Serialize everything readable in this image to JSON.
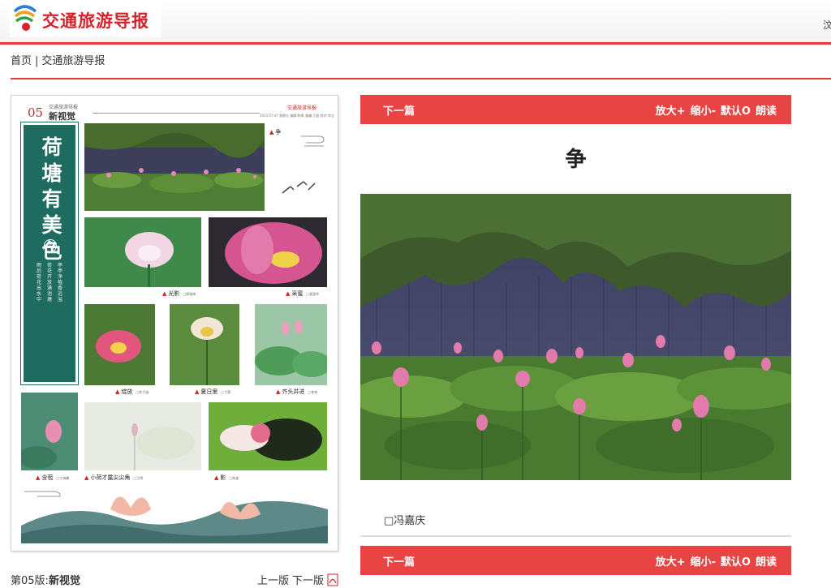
{
  "header": {
    "logo_text": "交通旅游导报",
    "right_text": "汶"
  },
  "breadcrumb": {
    "home": "首页",
    "separator": "|",
    "current": "交通旅游导报"
  },
  "paper": {
    "page_number": "05",
    "edition_small": "交通旅游导报",
    "edition_name": "新视觉",
    "brand": "交通旅游导报",
    "date_line": "2023.07.07 星期五 编辑:陈果 美编:王超 校对:李立",
    "feature_title": "荷塘有美色",
    "feature_number": "②",
    "side_text_1": "雨后荷花出水中",
    "side_text_2": "荷花开放满池塘",
    "side_text_3": "亭亭净植香远溢",
    "captions": [
      {
        "label": "光影",
        "author": "□周瑞琦"
      },
      {
        "label": "采蜜",
        "author": "□袁银华"
      },
      {
        "label": "绽放",
        "author": "□徐子涵"
      },
      {
        "label": "夏日里",
        "author": "□丁燕"
      },
      {
        "label": "齐头并进",
        "author": "□李林"
      },
      {
        "label": "含苞",
        "author": "□丁海峰"
      },
      {
        "label": "小荷才露尖尖角",
        "author": "□王明"
      },
      {
        "label": "影",
        "author": "□朱波"
      }
    ],
    "top_caption_side": "争"
  },
  "paper_footer": {
    "edition_label": "第05版:",
    "edition_name": "新视觉",
    "prev": "上一版",
    "next": "下一版"
  },
  "toolbar": {
    "next_article": "下一篇",
    "zoom_in": "放大+",
    "zoom_out": "缩小-",
    "default": "默认O",
    "read_aloud": "朗读"
  },
  "article": {
    "title": "争",
    "author": "□冯嘉庆"
  },
  "colors": {
    "accent_red": "#e94444",
    "feature_green": "#1e6b60"
  }
}
